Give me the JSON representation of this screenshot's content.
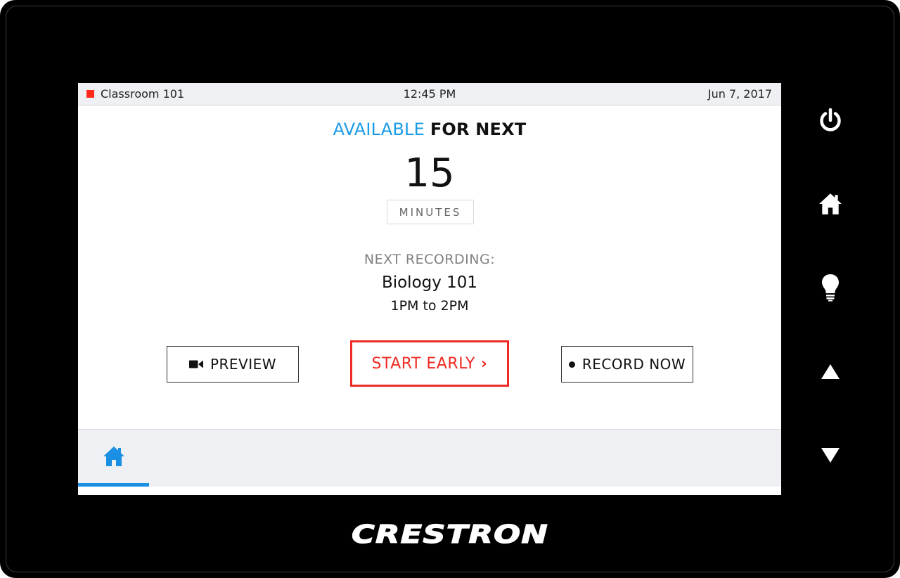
{
  "status": {
    "room": "Classroom 101",
    "time": "12:45 PM",
    "date": "Jun 7, 2017",
    "room_indicator_color": "#ff2a1a"
  },
  "availability": {
    "label_highlight": "AVAILABLE",
    "label_rest": "FOR NEXT",
    "count": "15",
    "unit": "MINUTES"
  },
  "next_recording": {
    "label": "NEXT RECORDING:",
    "course": "Biology 101",
    "time_range": "1PM to 2PM"
  },
  "actions": {
    "preview_label": "PREVIEW",
    "start_early_label": "START EARLY",
    "record_now_label": "RECORD NOW"
  },
  "nav": {
    "active_tab": "home"
  },
  "hardware_buttons": [
    "power-icon",
    "home-icon",
    "lightbulb-icon",
    "up-arrow-icon",
    "down-arrow-icon"
  ],
  "brand": {
    "logo_text": "CRESTRON"
  },
  "colors": {
    "accent_blue": "#1a9be8",
    "alert_red": "#ee2b24"
  }
}
